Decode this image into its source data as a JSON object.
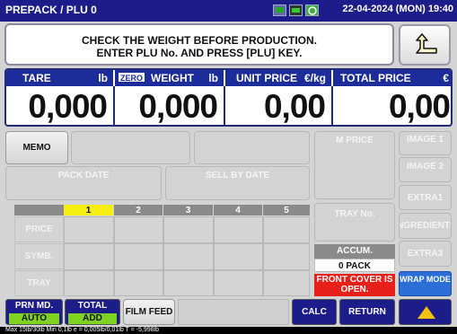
{
  "title_bar": {
    "mode_label": "PREPACK / PLU 0",
    "datetime": "22-04-2024 (MON) 19:40"
  },
  "message": {
    "line1": "CHECK THE WEIGHT BEFORE PRODUCTION.",
    "line2": "ENTER PLU No. AND PRESS [PLU] KEY."
  },
  "readouts": {
    "tare": {
      "label": "TARE",
      "unit": "lb",
      "value": "0,000"
    },
    "weight": {
      "zero_badge": "ZERO",
      "label": "WEIGHT",
      "unit": "lb",
      "value": "0,000"
    },
    "unit_price": {
      "label": "UNIT PRICE",
      "unit": "€/kg",
      "value": "0,00"
    },
    "total_price": {
      "label": "TOTAL PRICE",
      "unit": "€",
      "value": "0,00"
    }
  },
  "buttons": {
    "memo": "MEMO",
    "pack_date": "PACK DATE",
    "sell_by_date": "SELL BY DATE",
    "m_price": "M PRICE",
    "tray_no": "TRAY No.",
    "image1": "IMAGE 1",
    "image2": "IMAGE 2",
    "extra1": "EXTRA1",
    "ingredients": "INGREDIENTS",
    "extra3": "EXTRA3",
    "wrap_mode": "WRAP MODE",
    "film_feed": "FILM FEED",
    "calc": "CALC",
    "return": "RETURN"
  },
  "grid": {
    "columns": [
      "1",
      "2",
      "3",
      "4",
      "5"
    ],
    "selected_column": "1",
    "rows": [
      "PRICE",
      "SYMB.",
      "TRAY"
    ]
  },
  "accum": {
    "label": "ACCUM.",
    "value": "0 PACK"
  },
  "warning": {
    "line1": "FRONT COVER IS",
    "line2": "OPEN."
  },
  "bottom": {
    "prn_md": {
      "label": "PRN MD.",
      "value": "AUTO"
    },
    "total": {
      "label": "TOTAL",
      "value": "ADD"
    }
  },
  "status_line": "Max 15lb/30lb  Min 0,1lb  e = 0,005lb/0,01lb  T = -5,998lb",
  "colors": {
    "header_navy": "#1c1c8a",
    "readout_header": "#1c2c9a",
    "selected_column": "#f5ef12",
    "warning_red": "#e8201a",
    "mode_green": "#7ed321",
    "wrap_mode_blue": "#2b6ed6"
  },
  "icons": [
    "monitor-icon",
    "battery-icon",
    "network-icon",
    "return-arrow-icon",
    "up-arrow-icon"
  ]
}
